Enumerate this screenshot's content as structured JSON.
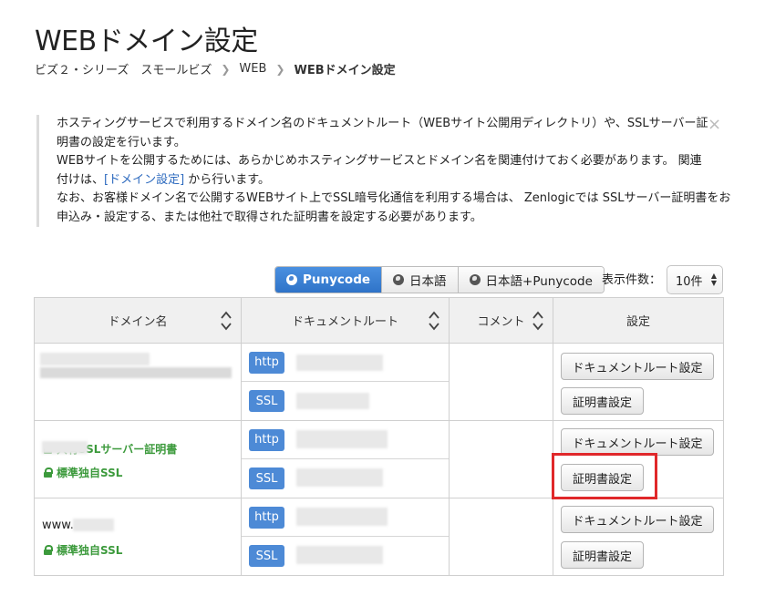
{
  "page": {
    "title": "WEBドメイン設定"
  },
  "breadcrumb": {
    "items": [
      "ビズ２・シリーズ　スモールビズ",
      "WEB",
      "WEBドメイン設定"
    ]
  },
  "info": {
    "line1": "ホスティングサービスで利用するドメイン名のドキュメントルート（WEBサイト公開用ディレクトリ）や、SSLサーバー証",
    "line2": "明書の設定を行います。",
    "line3": "WEBサイトを公開するためには、あらかじめホスティングサービスとドメイン名を関連付けておく必要があります。 関連",
    "line4_prefix": "付けは、",
    "line4_link": "[ドメイン設定]",
    "line4_suffix": " から行います。",
    "line5": "なお、お客様ドメイン名で公開するWEBサイト上でSSL暗号化通信を利用する場合は、 Zenlogicでは SSLサーバー証明書をお",
    "line6": "申込み・設定する、または他社で取得された証明書を設定する必要があります。",
    "close_glyph": "×"
  },
  "display_mode": {
    "options": [
      "Punycode",
      "日本語",
      "日本語+Punycode"
    ],
    "selected": "Punycode"
  },
  "per_page": {
    "label": "表示件数：",
    "value": "10件"
  },
  "table": {
    "headers": {
      "domain": "ドメイン名",
      "docroot": "ドキュメントルート",
      "comment": "コメント",
      "setting": "設定"
    },
    "rows": [
      {
        "domain_text": "",
        "ssl_status": "共有SSLサーバー証明書",
        "protocols": [
          "http",
          "SSL"
        ],
        "docroot_button": "ドキュメントルート設定",
        "cert_button": "証明書設定"
      },
      {
        "domain_text": "",
        "ssl_status": "標準独自SSL",
        "protocols": [
          "http",
          "SSL"
        ],
        "docroot_button": "ドキュメントルート設定",
        "cert_button": "証明書設定"
      },
      {
        "domain_text": "www.",
        "ssl_status": "標準独自SSL",
        "protocols": [
          "http",
          "SSL"
        ],
        "docroot_button": "ドキュメントルート設定",
        "cert_button": "証明書設定"
      }
    ]
  },
  "colors": {
    "accent_blue": "#2f73c8",
    "ssl_green": "#3c9a3c",
    "highlight_red": "#e0282a"
  }
}
